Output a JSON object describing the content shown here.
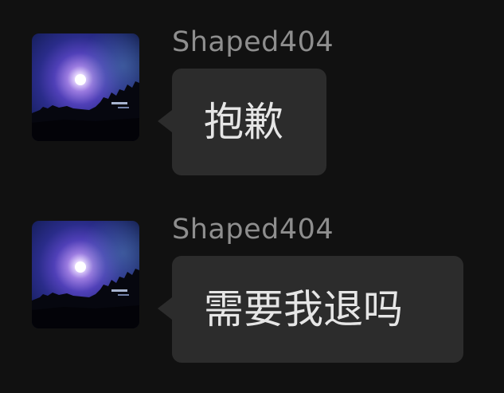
{
  "messages": [
    {
      "sender": "Shaped404",
      "text": "抱歉",
      "avatar": "night-moon-avatar"
    },
    {
      "sender": "Shaped404",
      "text": "需要我退吗",
      "avatar": "night-moon-avatar"
    }
  ],
  "colors": {
    "background": "#111111",
    "bubble": "#2c2c2c",
    "sender_name": "#8e8e8e",
    "message_text": "#e6e6e6"
  }
}
